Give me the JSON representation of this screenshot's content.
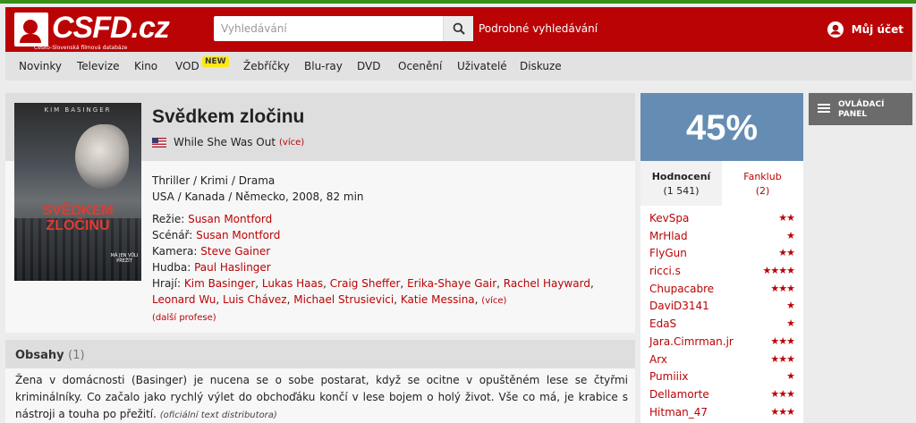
{
  "header": {
    "logo_text": "CSFD.cz",
    "logo_sub": "Česko-Slovenská filmová databáze",
    "search_placeholder": "Vyhledávání",
    "advanced_search": "Podrobné vyhledávání",
    "account": "Můj účet"
  },
  "nav": {
    "items": [
      "Novinky",
      "Televize",
      "Kino",
      "VOD",
      "Žebříčky",
      "Blu-ray",
      "DVD",
      "Ocenění",
      "Uživatelé",
      "Diskuze"
    ],
    "new_badge": "NEW"
  },
  "film": {
    "poster_actor": "KIM BASINGER",
    "poster_title": "SVĚDKEM ZLOČINU",
    "poster_tagline": "MÁ JEN VŮLI PŘEŽÍT",
    "title": "Svědkem zločinu",
    "original_title": "While She Was Out",
    "more": "(více)",
    "genres": "Thriller / Krimi / Drama",
    "origin": "USA / Kanada / Německo, 2008, 82 min",
    "credits": {
      "directing_label": "Režie:",
      "directing": "Susan Montford",
      "writing_label": "Scénář:",
      "writing": "Susan Montford",
      "camera_label": "Kamera:",
      "camera": "Steve Gainer",
      "music_label": "Hudba:",
      "music": "Paul Haslinger",
      "cast_label": "Hrají:",
      "cast": [
        "Kim Basinger",
        "Lukas Haas",
        "Craig Sheffer",
        "Erika-Shaye Gair",
        "Rachel Hayward",
        "Leonard Wu",
        "Luis Chávez",
        "Michael Strusievici",
        "Katie Messina"
      ],
      "cast_more": "(více)",
      "more_professions": "(další profese)"
    }
  },
  "plot": {
    "heading": "Obsahy",
    "count": "(1)",
    "text": "Žena v domácnosti (Basinger) je nucena se o sobe postarat, když se ocitne v opuštěném lese se čtyřmi kriminálníky. Co začalo jako rychlý výlet do obchoďáku končí v lese bojem o holý život. Vše co má, je krabice s nástroji a touha po přežití.",
    "source": "(oficiální text distributora)"
  },
  "rating": {
    "percent": "45%",
    "color": "#658db4",
    "tabs": [
      {
        "label": "Hodnocení",
        "count": "(1 541)"
      },
      {
        "label": "Fanklub",
        "count": "(2)"
      }
    ],
    "users": [
      {
        "name": "KevSpa",
        "stars": 2
      },
      {
        "name": "MrHlad",
        "stars": 1
      },
      {
        "name": "FlyGun",
        "stars": 2
      },
      {
        "name": "ricci.s",
        "stars": 4
      },
      {
        "name": "Chupacabre",
        "stars": 3
      },
      {
        "name": "DaviD3141",
        "stars": 1
      },
      {
        "name": "EdaS",
        "stars": 1
      },
      {
        "name": "Jara.Cimrman.jr",
        "stars": 3
      },
      {
        "name": "Arx",
        "stars": 3
      },
      {
        "name": "Pumiiix",
        "stars": 1
      },
      {
        "name": "Dellamorte",
        "stars": 3
      },
      {
        "name": "Hitman_47",
        "stars": 3
      }
    ]
  },
  "control_panel": {
    "line1": "OVLÁDACÍ",
    "line2": "PANEL"
  },
  "colors": {
    "brand_red": "#ba0305",
    "rating_blue": "#658db4"
  }
}
